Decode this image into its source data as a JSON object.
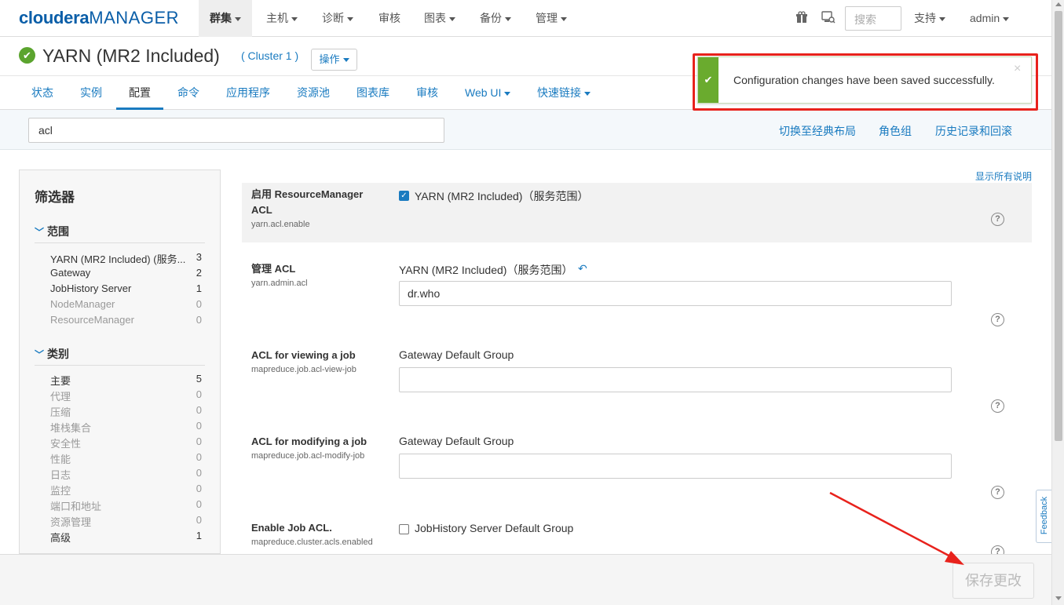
{
  "topbar": {
    "logo_part1": "cloudera",
    "logo_part2": "MANAGER",
    "nav": [
      {
        "label": "群集",
        "has_caret": true,
        "active": true
      },
      {
        "label": "主机",
        "has_caret": true,
        "active": false
      },
      {
        "label": "诊断",
        "has_caret": true,
        "active": false
      },
      {
        "label": "审核",
        "has_caret": false,
        "active": false
      },
      {
        "label": "图表",
        "has_caret": true,
        "active": false
      },
      {
        "label": "备份",
        "has_caret": true,
        "active": false
      },
      {
        "label": "管理",
        "has_caret": true,
        "active": false
      }
    ],
    "icons": [
      "gift-icon",
      "parcel-icon"
    ],
    "search_placeholder": "搜索",
    "support_label": "支持",
    "user_label": "admin"
  },
  "service": {
    "status_icon": "check-circle-icon",
    "status_color": "#5ba42e",
    "title": "YARN (MR2 Included)",
    "cluster": "( Cluster 1 )",
    "actions_label": "操作"
  },
  "tabs": [
    {
      "label": "状态",
      "active": false,
      "caret": false
    },
    {
      "label": "实例",
      "active": false,
      "caret": false
    },
    {
      "label": "配置",
      "active": true,
      "caret": false
    },
    {
      "label": "命令",
      "active": false,
      "caret": false
    },
    {
      "label": "应用程序",
      "active": false,
      "caret": false
    },
    {
      "label": "资源池",
      "active": false,
      "caret": false
    },
    {
      "label": "图表库",
      "active": false,
      "caret": false
    },
    {
      "label": "审核",
      "active": false,
      "caret": false
    },
    {
      "label": "Web UI",
      "active": false,
      "caret": true
    },
    {
      "label": "快速链接",
      "active": false,
      "caret": true
    }
  ],
  "config_search": {
    "value": "acl",
    "links": [
      "切换至经典布局",
      "角色组",
      "历史记录和回滚"
    ]
  },
  "filter": {
    "title": "筛选器",
    "scope_heading": "范围",
    "scope_items": [
      {
        "label": "YARN (MR2 Included) (服务...",
        "count": "3",
        "enabled": true
      },
      {
        "label": "Gateway",
        "count": "2",
        "enabled": true
      },
      {
        "label": "JobHistory Server",
        "count": "1",
        "enabled": true
      },
      {
        "label": "NodeManager",
        "count": "0",
        "enabled": false
      },
      {
        "label": "ResourceManager",
        "count": "0",
        "enabled": false
      }
    ],
    "category_heading": "类别",
    "category_items": [
      {
        "label": "主要",
        "count": "5",
        "enabled": true
      },
      {
        "label": "代理",
        "count": "0",
        "enabled": false
      },
      {
        "label": "压缩",
        "count": "0",
        "enabled": false
      },
      {
        "label": "堆栈集合",
        "count": "0",
        "enabled": false
      },
      {
        "label": "安全性",
        "count": "0",
        "enabled": false
      },
      {
        "label": "性能",
        "count": "0",
        "enabled": false
      },
      {
        "label": "日志",
        "count": "0",
        "enabled": false
      },
      {
        "label": "监控",
        "count": "0",
        "enabled": false
      },
      {
        "label": "端口和地址",
        "count": "0",
        "enabled": false
      },
      {
        "label": "资源管理",
        "count": "0",
        "enabled": false
      },
      {
        "label": "高级",
        "count": "1",
        "enabled": true
      }
    ]
  },
  "show_all_label": "显示所有说明",
  "configs": [
    {
      "name": "启用 ResourceManager ACL",
      "key": "yarn.acl.enable",
      "scope": "YARN (MR2 Included)（服务范围）",
      "type": "checkbox",
      "checked": true
    },
    {
      "name": "管理 ACL",
      "key": "yarn.admin.acl",
      "scope": "YARN (MR2 Included)（服务范围）",
      "type": "text",
      "value": "dr.who",
      "modified": true
    },
    {
      "name": "ACL for viewing a job",
      "key": "mapreduce.job.acl-view-job",
      "scope": "Gateway Default Group",
      "type": "text",
      "value": ""
    },
    {
      "name": "ACL for modifying a job",
      "key": "mapreduce.job.acl-modify-job",
      "scope": "Gateway Default Group",
      "type": "text",
      "value": ""
    },
    {
      "name": "Enable Job ACL.",
      "key": "mapreduce.cluster.acls.enabled",
      "scope": "JobHistory Server Default Group",
      "type": "checkbox",
      "checked": false
    }
  ],
  "footer": {
    "save_label": "保存更改"
  },
  "feedback_label": "Feedback",
  "toast": {
    "message": "Configuration changes have been saved successfully.",
    "close": "×",
    "color": "#6aab2e"
  },
  "annotation_color": "#e8221c"
}
